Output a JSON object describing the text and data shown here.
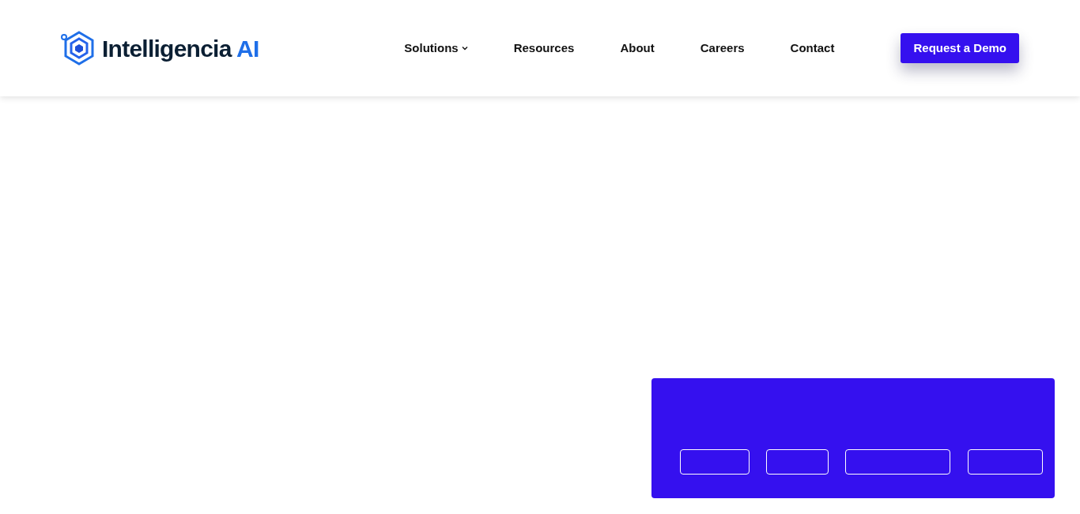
{
  "logo": {
    "name": "Intelligencia",
    "suffix": "AI"
  },
  "nav": [
    {
      "label": "Solutions",
      "dropdown": true
    },
    {
      "label": "Resources",
      "dropdown": false
    },
    {
      "label": "About",
      "dropdown": false
    },
    {
      "label": "Careers",
      "dropdown": false
    },
    {
      "label": "Contact",
      "dropdown": false
    }
  ],
  "cta": {
    "label": "Request a Demo"
  },
  "banner": {
    "buttons": [
      {
        "kind": "outline"
      },
      {
        "kind": "outline"
      },
      {
        "kind": "outline"
      },
      {
        "kind": "outline"
      }
    ]
  }
}
